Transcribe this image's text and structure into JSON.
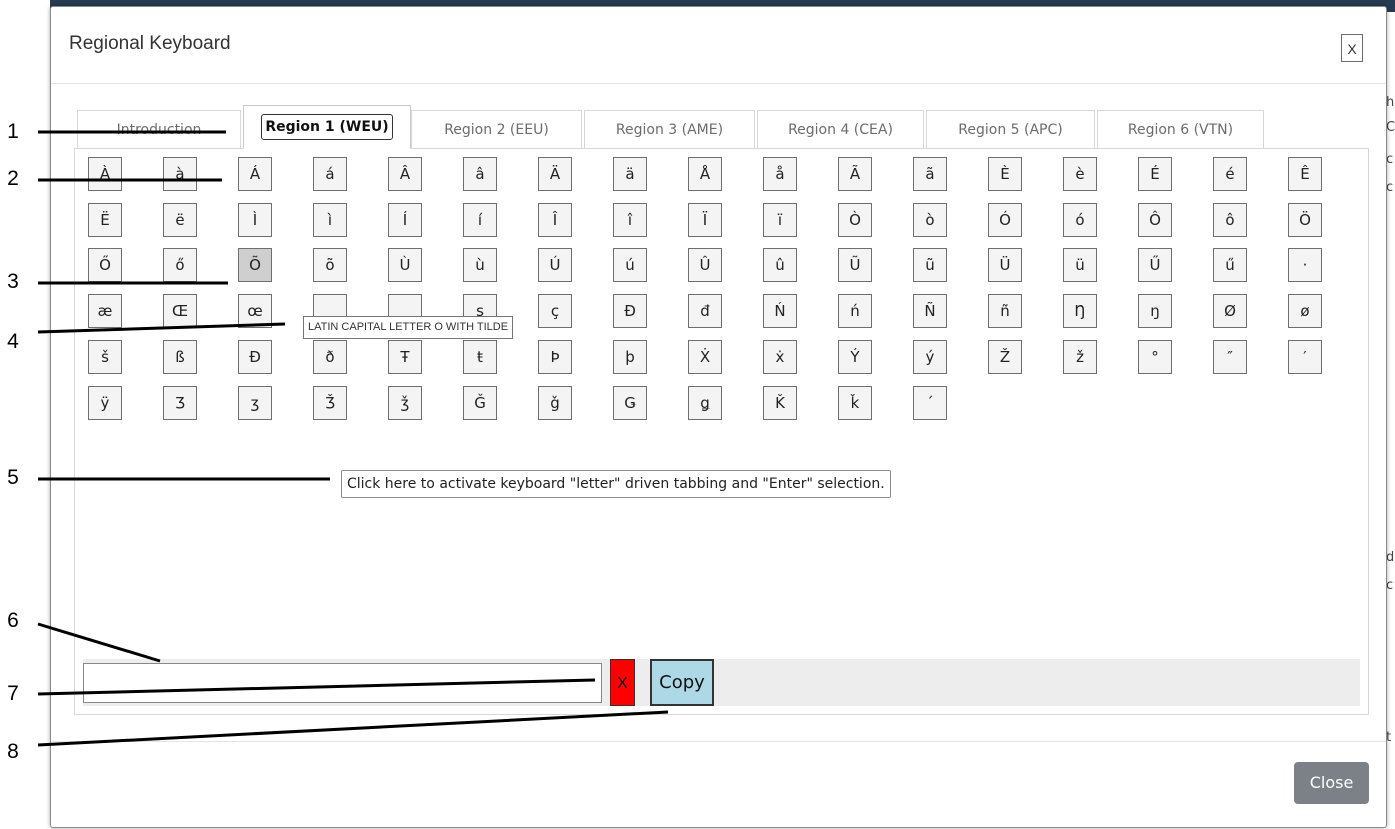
{
  "modal": {
    "title": "Regional Keyboard",
    "header_close_label": "X",
    "footer_close_label": "Close"
  },
  "tabs": [
    {
      "label": "Introduction",
      "active": false
    },
    {
      "label": "Region 1 (WEU)",
      "active": true
    },
    {
      "label": "Region 2 (EEU)",
      "active": false
    },
    {
      "label": "Region 3 (AME)",
      "active": false
    },
    {
      "label": "Region 4 (CEA)",
      "active": false
    },
    {
      "label": "Region 5 (APC)",
      "active": false
    },
    {
      "label": "Region 6 (VTN)",
      "active": false
    }
  ],
  "keyboard": {
    "rows": [
      [
        "À",
        "à",
        "Á",
        "á",
        "Â",
        "â",
        "Ä",
        "ä",
        "Å",
        "å",
        "Ã",
        "ã",
        "È",
        "è",
        "É",
        "é",
        "Ê"
      ],
      [
        "Ë",
        "ë",
        "Ì",
        "ì",
        "Í",
        "í",
        "Î",
        "î",
        "Ï",
        "ï",
        "Ò",
        "ò",
        "Ó",
        "ó",
        "Ô",
        "ô",
        "Ö"
      ],
      [
        "Ő",
        "ő",
        "Õ",
        "õ",
        "Ù",
        "ù",
        "Ú",
        "ú",
        "Û",
        "û",
        "Ũ",
        "ũ",
        "Ü",
        "ü",
        "Ű",
        "ű",
        "·"
      ],
      [
        "æ",
        "Œ",
        "œ",
        "",
        "",
        "ş",
        "ç",
        "Đ",
        "đ",
        "Ń",
        "ń",
        "Ñ",
        "ñ",
        "Ŋ",
        "ŋ",
        "Ø",
        "ø"
      ],
      [
        "š",
        "ß",
        "Ð",
        "ð",
        "Ŧ",
        "ŧ",
        "Þ",
        "þ",
        "Ẋ",
        "ẋ",
        "Ý",
        "ý",
        "Ž",
        "ž",
        "°",
        "″",
        "′"
      ],
      [
        "ÿ",
        "Ʒ",
        "ʒ",
        "Ǯ",
        "ǯ",
        "Ǧ",
        "ǧ",
        "Ǥ",
        "ǥ",
        "Ǩ",
        "ǩ",
        "´"
      ]
    ],
    "hovered_key": "Õ",
    "tooltip": "LATIN CAPITAL LETTER O WITH TILDE"
  },
  "activate_hint": "Click here to activate keyboard \"letter\" driven tabbing and \"Enter\" selection.",
  "output": {
    "value": "",
    "placeholder": "",
    "clear_label": "X",
    "copy_label": "Copy"
  },
  "callouts": [
    "1",
    "2",
    "3",
    "4",
    "5",
    "6",
    "7",
    "8"
  ],
  "colors": {
    "clear_button": "#ff0000",
    "copy_button": "#add8e6",
    "close_button": "#7b8186",
    "hovered_key": "#cfcfcf"
  }
}
